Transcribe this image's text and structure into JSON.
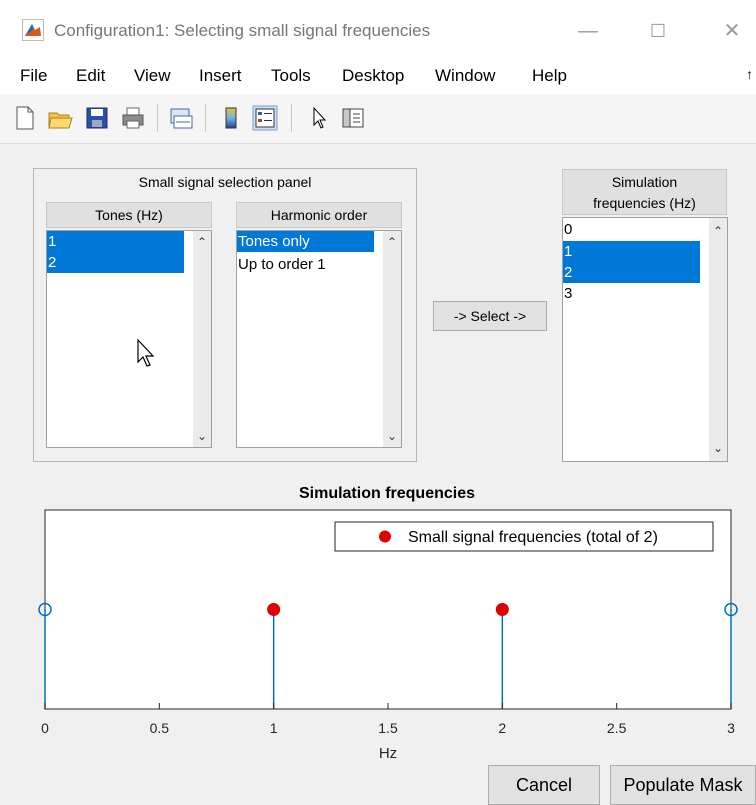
{
  "window": {
    "title": "Configuration1: Selecting small signal frequencies",
    "minimize": "—",
    "maximize": "☐",
    "close": "✕"
  },
  "menu": [
    "File",
    "Edit",
    "View",
    "Insert",
    "Tools",
    "Desktop",
    "Window",
    "Help"
  ],
  "menu_overflow": "↑",
  "toolbar": {
    "items": [
      "new-file-icon",
      "open-folder-icon",
      "save-icon",
      "print-icon",
      "link-plot-icon",
      "colorbar-icon",
      "legend-icon",
      "edit-plot-arrow-icon",
      "property-inspector-icon"
    ]
  },
  "selection_panel": {
    "title": "Small signal selection panel",
    "tones": {
      "header": "Tones (Hz)",
      "items": [
        "1",
        "2"
      ],
      "selected": [
        0,
        1
      ]
    },
    "harmonic": {
      "header": "Harmonic order",
      "items": [
        "Tones only",
        "Up to order 1"
      ],
      "selected": [
        0
      ]
    }
  },
  "select_button": "-> Select ->",
  "simulation_list": {
    "header_line1": "Simulation",
    "header_line2": "frequencies (Hz)",
    "items": [
      "0",
      "1",
      "2",
      "3"
    ],
    "selected": [
      1,
      2
    ]
  },
  "chart_data": {
    "type": "scatter",
    "title": "Simulation frequencies",
    "xlabel": "Hz",
    "ylabel": "",
    "xlim": [
      0,
      3
    ],
    "ylim": [
      0,
      1
    ],
    "x_ticks": [
      "0",
      "0.5",
      "1",
      "1.5",
      "2",
      "2.5",
      "3"
    ],
    "stems": [
      {
        "x": 0,
        "y": 0.5,
        "marker": "hollow",
        "color": "#0072bd"
      },
      {
        "x": 1,
        "y": 0.5,
        "marker": "filled",
        "color": "#e00000"
      },
      {
        "x": 2,
        "y": 0.5,
        "marker": "filled",
        "color": "#e00000"
      },
      {
        "x": 3,
        "y": 0.5,
        "marker": "hollow",
        "color": "#0072bd"
      }
    ],
    "legend": {
      "entry": "Small signal frequencies (total of 2)",
      "color": "#e00000",
      "placement": "top-right"
    },
    "grid": false,
    "colors": {
      "stem": "#0072bd",
      "highlight": "#e00000"
    }
  },
  "buttons": {
    "cancel": "Cancel",
    "populate": "Populate Mask"
  },
  "accent": "#0078d7"
}
